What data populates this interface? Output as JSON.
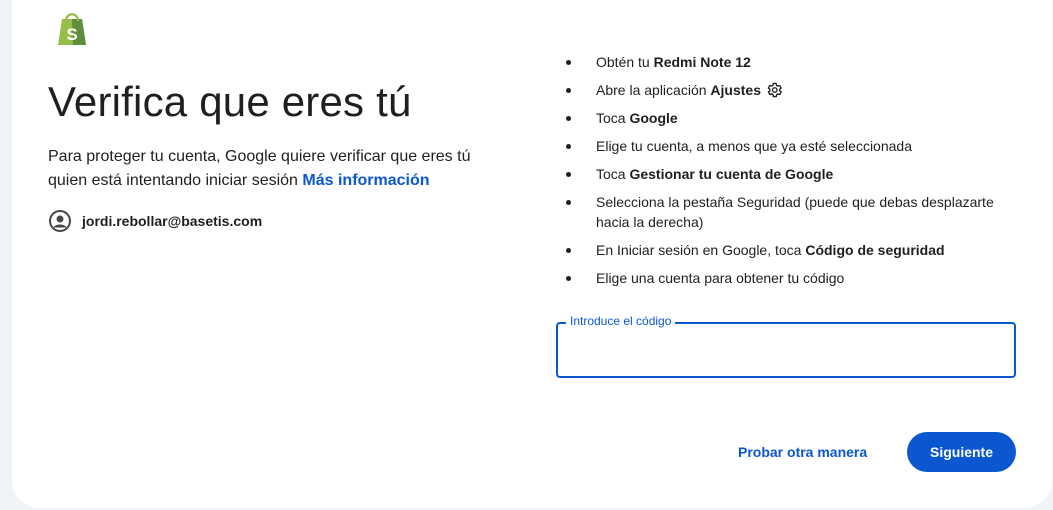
{
  "brand": {
    "logo_icon": "shopify-bag-icon",
    "logo_letter": "S",
    "logo_color": "#95bf47"
  },
  "heading": {
    "title": "Verifica que eres tú",
    "subtitle": "Para proteger tu cuenta, Google quiere verificar que eres tú quien está intentando iniciar sesión",
    "more_info_link": "Más información"
  },
  "account": {
    "icon": "account-circle-icon",
    "email": "jordi.rebollar@basetis.com"
  },
  "steps": [
    {
      "pre": "Obtén tu ",
      "bold": "Redmi Note 12",
      "post": ""
    },
    {
      "pre": "Abre la aplicación ",
      "bold": "Ajustes",
      "post": "",
      "icon": "gear-icon"
    },
    {
      "pre": "Toca ",
      "bold": "Google",
      "post": ""
    },
    {
      "pre": "Elige tu cuenta, a menos que ya esté seleccionada",
      "bold": "",
      "post": ""
    },
    {
      "pre": "Toca ",
      "bold": "Gestionar tu cuenta de Google",
      "post": ""
    },
    {
      "pre": "Selecciona la pestaña Seguridad (puede que debas desplazarte hacia la derecha)",
      "bold": "",
      "post": ""
    },
    {
      "pre": "En Iniciar sesión en Google, toca ",
      "bold": "Código de seguridad",
      "post": ""
    },
    {
      "pre": "Elige una cuenta para obtener tu código",
      "bold": "",
      "post": ""
    }
  ],
  "code_field": {
    "label": "Introduce el código",
    "value": ""
  },
  "actions": {
    "try_another": "Probar otra manera",
    "next": "Siguiente"
  },
  "colors": {
    "accent": "#0b57d0",
    "background": "#f0f4f9",
    "card": "#ffffff"
  }
}
